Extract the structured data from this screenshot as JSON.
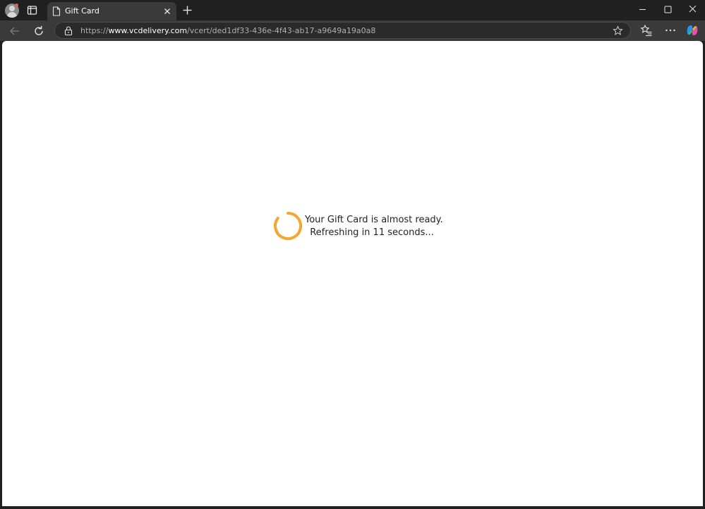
{
  "browser": {
    "tab": {
      "title": "Gift Card"
    },
    "address_bar": {
      "scheme": "https://",
      "host": "www.vcdelivery.com",
      "path": "/vcert/ded1df33-436e-4f43-ab17-a9649a19a0a8"
    }
  },
  "page": {
    "message_line1": "Your Gift Card is almost ready.",
    "message_line2": "Refreshing in 11 seconds..."
  },
  "colors": {
    "spinner": "#f0a830",
    "chrome_bg": "#202020",
    "toolbar_bg": "#3a3a3a",
    "page_bg": "#ffffff"
  },
  "icons": {
    "profile": "profile-avatar-icon",
    "tab_actions": "tab-actions-icon",
    "favicon": "page-icon",
    "tab_close": "close-icon",
    "new_tab": "plus-icon",
    "back": "arrow-left-icon",
    "refresh": "refresh-icon",
    "site_info": "lock-icon",
    "favorite": "star-icon",
    "favorites": "favorites-icon",
    "more": "ellipsis-icon",
    "copilot": "copilot-icon",
    "spinner": "loading-spinner-icon"
  }
}
